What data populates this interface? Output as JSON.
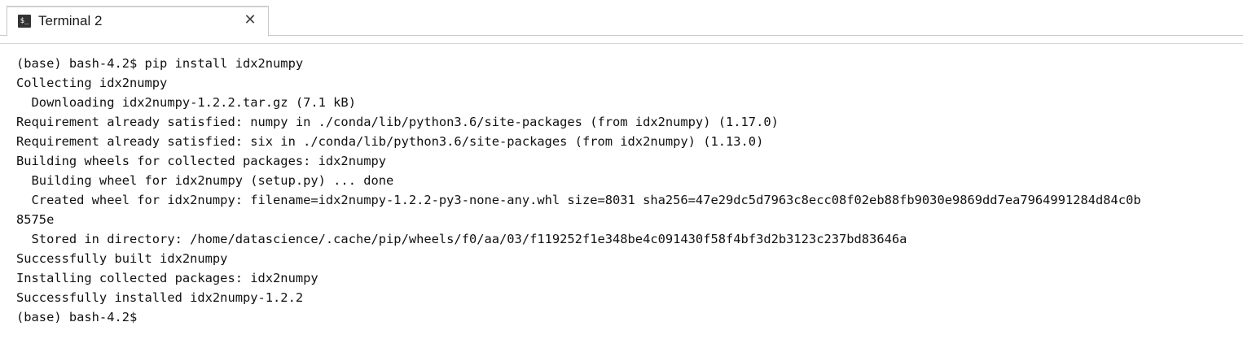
{
  "tab": {
    "title": "Terminal 2",
    "icon": "terminal-icon",
    "icon_glyph": "$_",
    "close_glyph": "✕"
  },
  "terminal": {
    "lines": [
      "(base) bash-4.2$ pip install idx2numpy",
      "Collecting idx2numpy",
      "  Downloading idx2numpy-1.2.2.tar.gz (7.1 kB)",
      "Requirement already satisfied: numpy in ./conda/lib/python3.6/site-packages (from idx2numpy) (1.17.0)",
      "Requirement already satisfied: six in ./conda/lib/python3.6/site-packages (from idx2numpy) (1.13.0)",
      "Building wheels for collected packages: idx2numpy",
      "  Building wheel for idx2numpy (setup.py) ... done",
      "  Created wheel for idx2numpy: filename=idx2numpy-1.2.2-py3-none-any.whl size=8031 sha256=47e29dc5d7963c8ecc08f02eb88fb9030e9869dd7ea7964991284d84c0b",
      "8575e",
      "  Stored in directory: /home/datascience/.cache/pip/wheels/f0/aa/03/f119252f1e348be4c091430f58f4bf3d2b3123c237bd83646a",
      "Successfully built idx2numpy",
      "Installing collected packages: idx2numpy",
      "Successfully installed idx2numpy-1.2.2",
      "(base) bash-4.2$"
    ]
  },
  "colors": {
    "highlight": "#ffff00",
    "text": "#111111",
    "background": "#ffffff"
  }
}
